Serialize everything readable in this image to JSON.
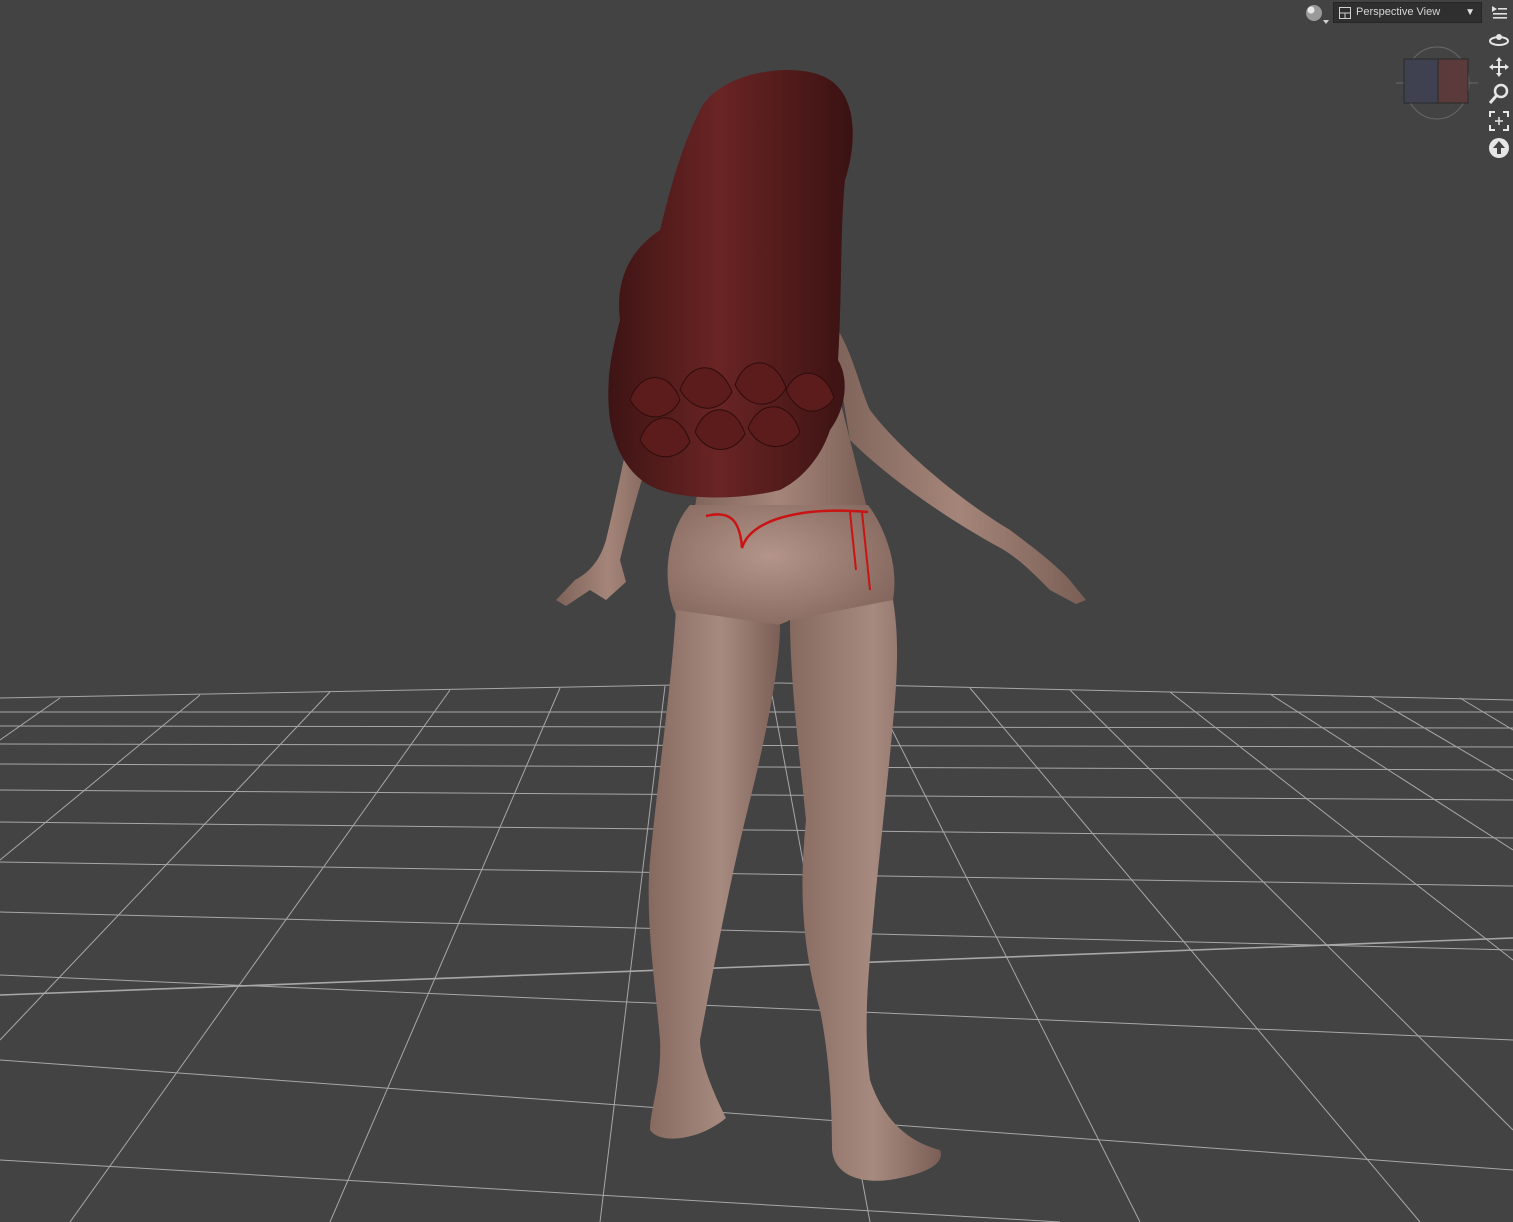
{
  "viewport": {
    "view_label": "Perspective View",
    "dropdown_arrow": "▼",
    "icons": {
      "render": "render-sphere-icon",
      "view": "view-layout-icon",
      "menu": "viewport-menu-icon",
      "cube": "view-cube",
      "orbit": "orbit-icon",
      "pan": "pan-icon",
      "zoom": "zoom-icon",
      "frame": "frame-icon",
      "reset": "reset-view-icon"
    },
    "colors": {
      "background": "#434343",
      "grid": "#b8b8b8",
      "hair": "#5a1e1e",
      "skin": "#9a7b71",
      "string": "#c81414"
    }
  }
}
